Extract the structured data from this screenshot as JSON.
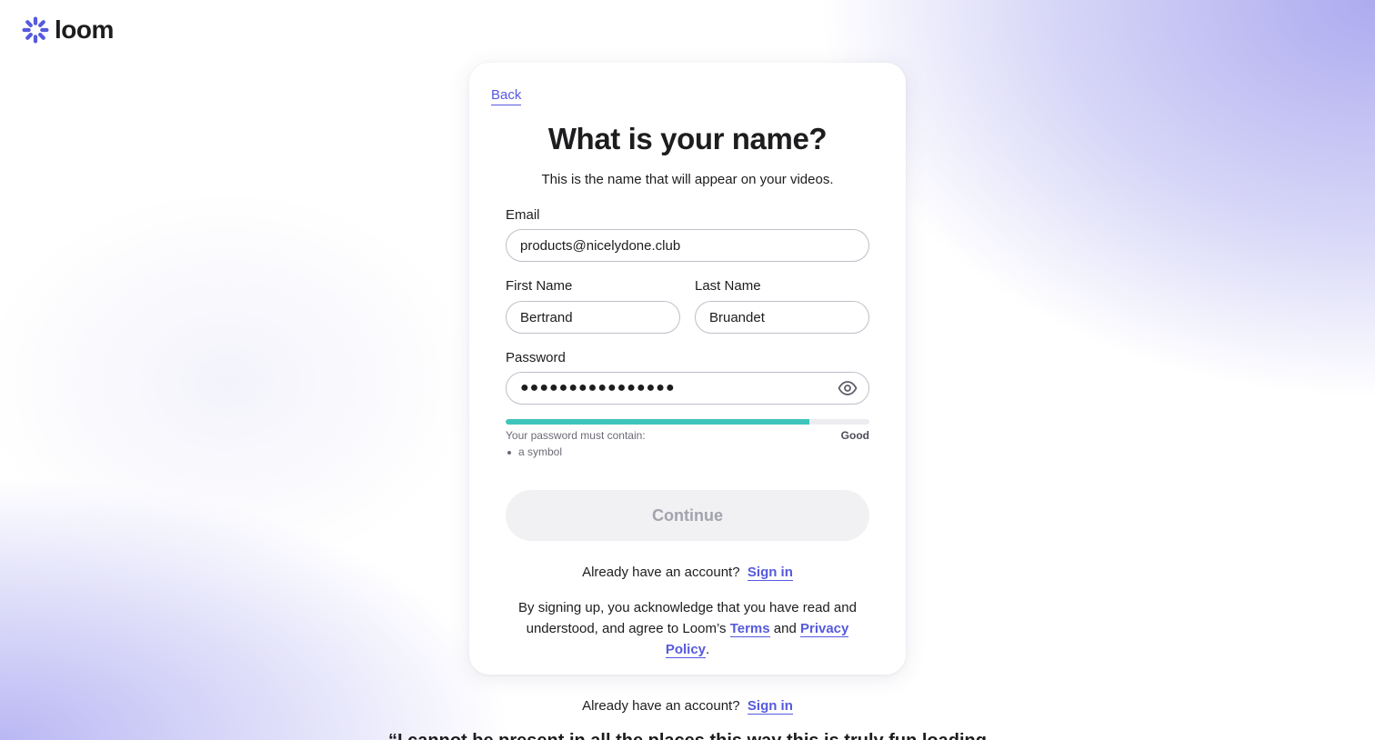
{
  "brand": {
    "name": "loom",
    "accent_color": "#565add"
  },
  "signup": {
    "back_label": "Back",
    "title": "What is your name?",
    "subtitle": "This is the name that will appear on your videos.",
    "email": {
      "label": "Email",
      "value": "products@nicelydone.club"
    },
    "first_name": {
      "label": "First Name",
      "value": "Bertrand"
    },
    "last_name": {
      "label": "Last Name",
      "value": "Bruandet"
    },
    "password": {
      "label": "Password",
      "value": "●●●●●●●●●●●●●●●●",
      "toggle_icon": "eye-icon"
    },
    "strength": {
      "percent": 83.5,
      "color": "#3fc4bb",
      "hint": "Your password must contain:",
      "level": "Good",
      "requirements": [
        "a symbol"
      ]
    },
    "continue_label": "Continue",
    "account": {
      "prompt": "Already have an account?",
      "sign_in_label": "Sign in"
    },
    "legal": {
      "prefix": "By signing up, you acknowledge that you have read and understood, and agree to Loom’s",
      "terms_label": "Terms",
      "conjunction": "and",
      "privacy_label": "Privacy Policy",
      "suffix": "."
    }
  },
  "footer": {
    "prompt": "Already have an account?",
    "sign_in_label": "Sign in",
    "quote_partial": "“I cannot be present in all the places this way this is truly fun loading"
  }
}
